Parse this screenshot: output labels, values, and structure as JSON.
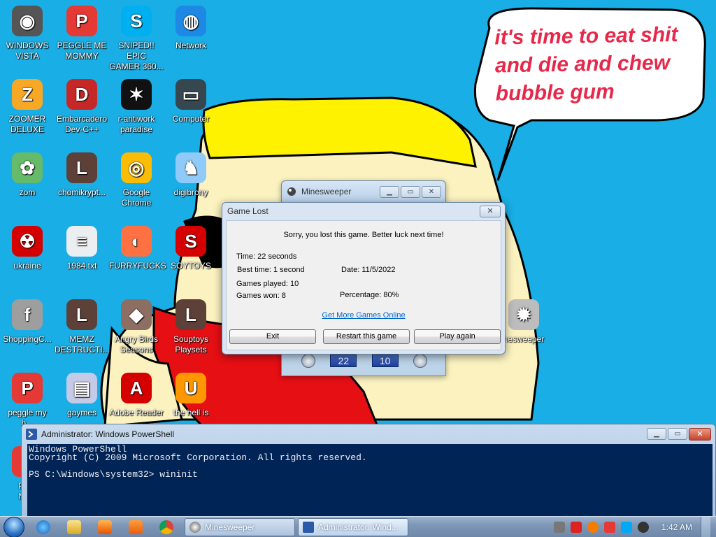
{
  "wallpaper": {
    "bubble_lines": [
      "it's time to eat shit",
      "and die and chew",
      "bubble gum"
    ]
  },
  "desktop_icons": [
    {
      "label": "WINDOWS\nVISTA",
      "icon": "windows-vista-icon"
    },
    {
      "label": "PEGGLE ME\nMOMMY",
      "icon": "peggle-icon"
    },
    {
      "label": "SNIPED!! EPIC\nGAMER 360...",
      "icon": "skype-icon"
    },
    {
      "label": "Network",
      "icon": "network-icon"
    },
    {
      "label": "ZOOMER\nDELUXE",
      "icon": "zoomer-icon"
    },
    {
      "label": "Embarcadero\nDev-C++",
      "icon": "devcpp-icon"
    },
    {
      "label": "r-antiwork\nparadise",
      "icon": "antiwork-icon"
    },
    {
      "label": "Computer",
      "icon": "computer-icon"
    },
    {
      "label": "zom",
      "icon": "flower-icon"
    },
    {
      "label": "chomikrypt...",
      "icon": "shortcut-l-icon"
    },
    {
      "label": "Google\nChrome",
      "icon": "chrome-icon"
    },
    {
      "label": "digibrony",
      "icon": "digibrony-icon"
    },
    {
      "label": "ukraine",
      "icon": "radiation-icon"
    },
    {
      "label": "1984.txt",
      "icon": "text-file-icon"
    },
    {
      "label": "FURRYFUCKS",
      "icon": "firefox-icon"
    },
    {
      "label": "SOYTOYS",
      "icon": "soytoys-icon"
    },
    {
      "label": "ShoppingC...",
      "icon": "flash-icon"
    },
    {
      "label": "MEMZ\nDESTRUCTI...",
      "icon": "shortcut-l-icon"
    },
    {
      "label": "Angry Birds\nSeasons",
      "icon": "angry-birds-icon"
    },
    {
      "label": "Souptoys\nPlaysets",
      "icon": "shortcut-l-icon"
    },
    {
      "label": "peggle my\nh...",
      "icon": "peggle-icon"
    },
    {
      "label": "gaymes",
      "icon": "folder-icon"
    },
    {
      "label": "Adobe Reader",
      "icon": "adobe-reader-icon"
    },
    {
      "label": "the hell is",
      "icon": "uc-browser-icon"
    },
    {
      "label": "PEG\nNEC",
      "icon": "peggle-icon"
    },
    {
      "label": "nesweeper",
      "icon": "minesweeper-icon"
    }
  ],
  "minesweeper": {
    "title": "Minesweeper",
    "time_counter": "22",
    "mine_counter": "10"
  },
  "dialog": {
    "title": "Game Lost",
    "close": "✕",
    "message": "Sorry, you lost this game. Better luck next time!",
    "time": "Time: 22 seconds",
    "best_time": "Best time: 1 second",
    "date": "Date: 11/5/2022",
    "games_played": "Games played: 10",
    "games_won": "Games won: 8",
    "percentage": "Percentage: 80%",
    "link": "Get More Games Online",
    "buttons": {
      "exit": "Exit",
      "restart": "Restart this game",
      "play_again": "Play again"
    }
  },
  "powershell": {
    "title": "Administrator: Windows PowerShell",
    "lines": "Windows PowerShell\nCopyright (C) 2009 Microsoft Corporation. All rights reserved.\n\nPS C:\\Windows\\system32> wininit"
  },
  "taskbar": {
    "tasks": [
      {
        "label": "Minesweeper",
        "icon": "minesweeper-icon"
      },
      {
        "label": "Administrator: Wind...",
        "icon": "powershell-icon"
      }
    ],
    "clock": "1:42 AM"
  },
  "colors": {
    "desktop_bg": "#19aee6",
    "bubble_text": "#e8284a",
    "console_bg": "#012456"
  }
}
